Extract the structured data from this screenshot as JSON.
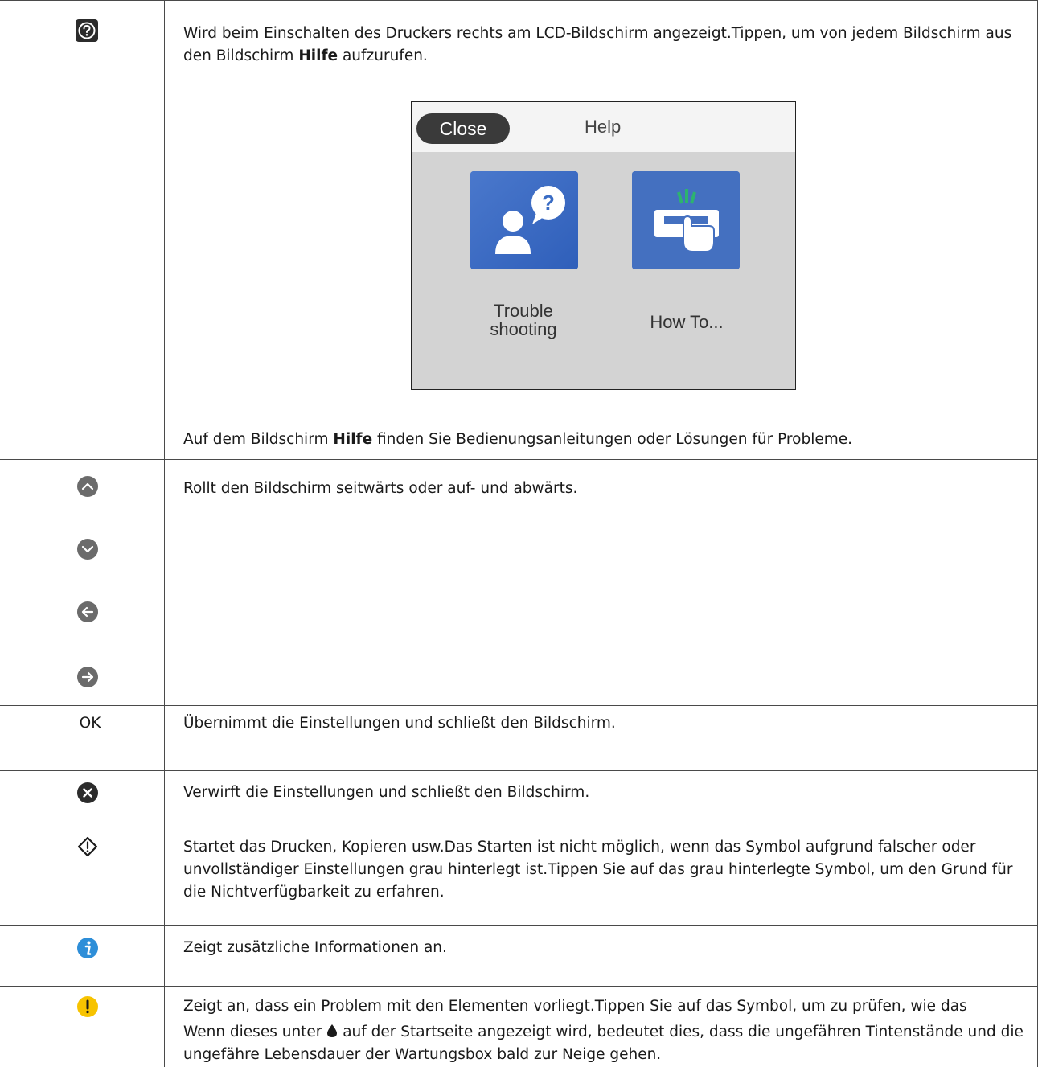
{
  "rows": {
    "help": {
      "icon": "help-circle-icon",
      "text_before": "Wird beim Einschalten des Druckers rechts am LCD-Bildschirm angezeigt.Tippen, um von jedem Bildschirm aus den Bildschirm ",
      "text_bold": "Hilfe",
      "text_after": " aufzurufen.",
      "footer_before": "Auf dem Bildschirm ",
      "footer_bold": "Hilfe",
      "footer_after": " finden Sie Bedienungsanleitungen oder Lösungen für Probleme."
    },
    "scroll": {
      "icons": [
        "arrow-up-icon",
        "arrow-down-icon",
        "arrow-left-icon",
        "arrow-right-icon"
      ],
      "text": "Rollt den Bildschirm seitwärts oder auf- und abwärts."
    },
    "ok": {
      "label": "OK",
      "text": "Übernimmt die Einstellungen und schließt den Bildschirm."
    },
    "cancel": {
      "icon": "close-circle-icon",
      "text": "Verwirft die Einstellungen und schließt den Bildschirm."
    },
    "start": {
      "icon": "start-diamond-icon",
      "text": "Startet das Drucken, Kopieren usw.Das Starten ist nicht möglich, wenn das Symbol aufgrund falscher oder unvollständiger Einstellungen grau hinterlegt ist.Tippen Sie auf das grau hinterlegte Symbol, um den Grund für die Nichtverfügbarkeit zu erfahren."
    },
    "info": {
      "icon": "info-icon",
      "text": "Zeigt zusätzliche Informationen an."
    },
    "warning": {
      "icon": "warning-icon",
      "text": "Zeigt an, dass ein Problem mit den Elementen vorliegt.Tippen Sie auf das Symbol, um zu prüfen, wie das Problem gelöst werden kann.",
      "text2_before": "Wenn dieses unter ",
      "text2_icon": "ink-drop-icon",
      "text2_after": " auf der Startseite angezeigt wird, bedeutet dies, dass die ungefähren Tintenstände und die ungefähre Lebensdauer der Wartungsbox bald zur Neige gehen."
    }
  },
  "lcd": {
    "close_label": "Close",
    "title": "Help",
    "tiles": [
      {
        "icon": "troubleshooting-icon",
        "label_line1": "Trouble",
        "label_line2": "shooting"
      },
      {
        "icon": "how-to-icon",
        "label": "How To..."
      }
    ]
  },
  "colors": {
    "icon_gray": "#6b6b6b",
    "icon_dark": "#2c2c2c",
    "info_blue": "#2e8ed8",
    "warning_yellow": "#f7c300",
    "tile_blue": "#3a6cc4"
  }
}
